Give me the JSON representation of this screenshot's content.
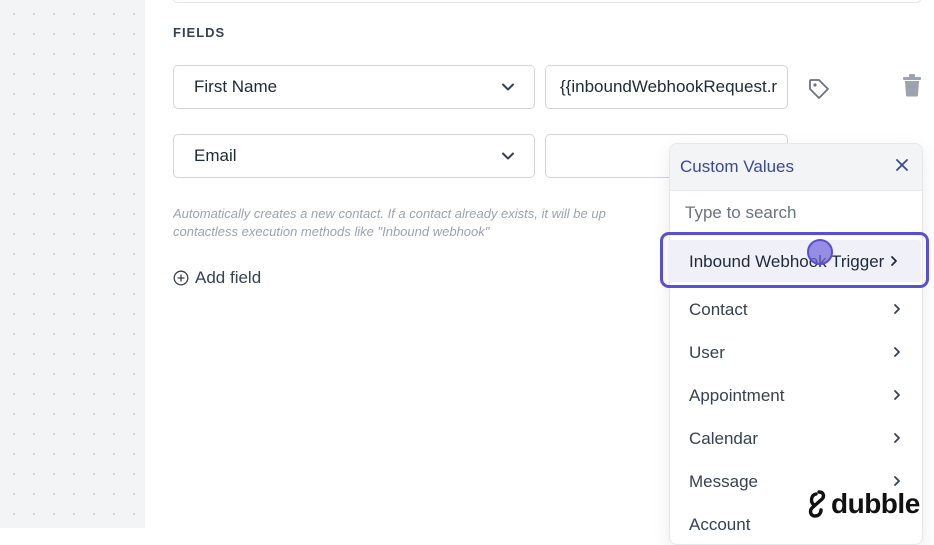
{
  "section": {
    "label": "FIELDS"
  },
  "fields": [
    {
      "field": "First Name",
      "value": "{{inboundWebhookRequest.r"
    },
    {
      "field": "Email",
      "value": ""
    }
  ],
  "help_text": {
    "line1": "Automatically creates a new contact. If a contact already exists, it will be up",
    "line2": "contactless execution methods like \"Inbound webhook\""
  },
  "add_field_label": "Add field",
  "dropdown": {
    "title": "Custom Values",
    "search_placeholder": "Type to search",
    "items": [
      {
        "label": "Inbound Webhook Trigger"
      },
      {
        "label": "Contact"
      },
      {
        "label": "User"
      },
      {
        "label": "Appointment"
      },
      {
        "label": "Calendar"
      },
      {
        "label": "Message"
      },
      {
        "label": "Account"
      }
    ]
  },
  "watermark": "dubble",
  "colors": {
    "accent": "#5b4fd1",
    "header_text": "#3b4a8c"
  }
}
